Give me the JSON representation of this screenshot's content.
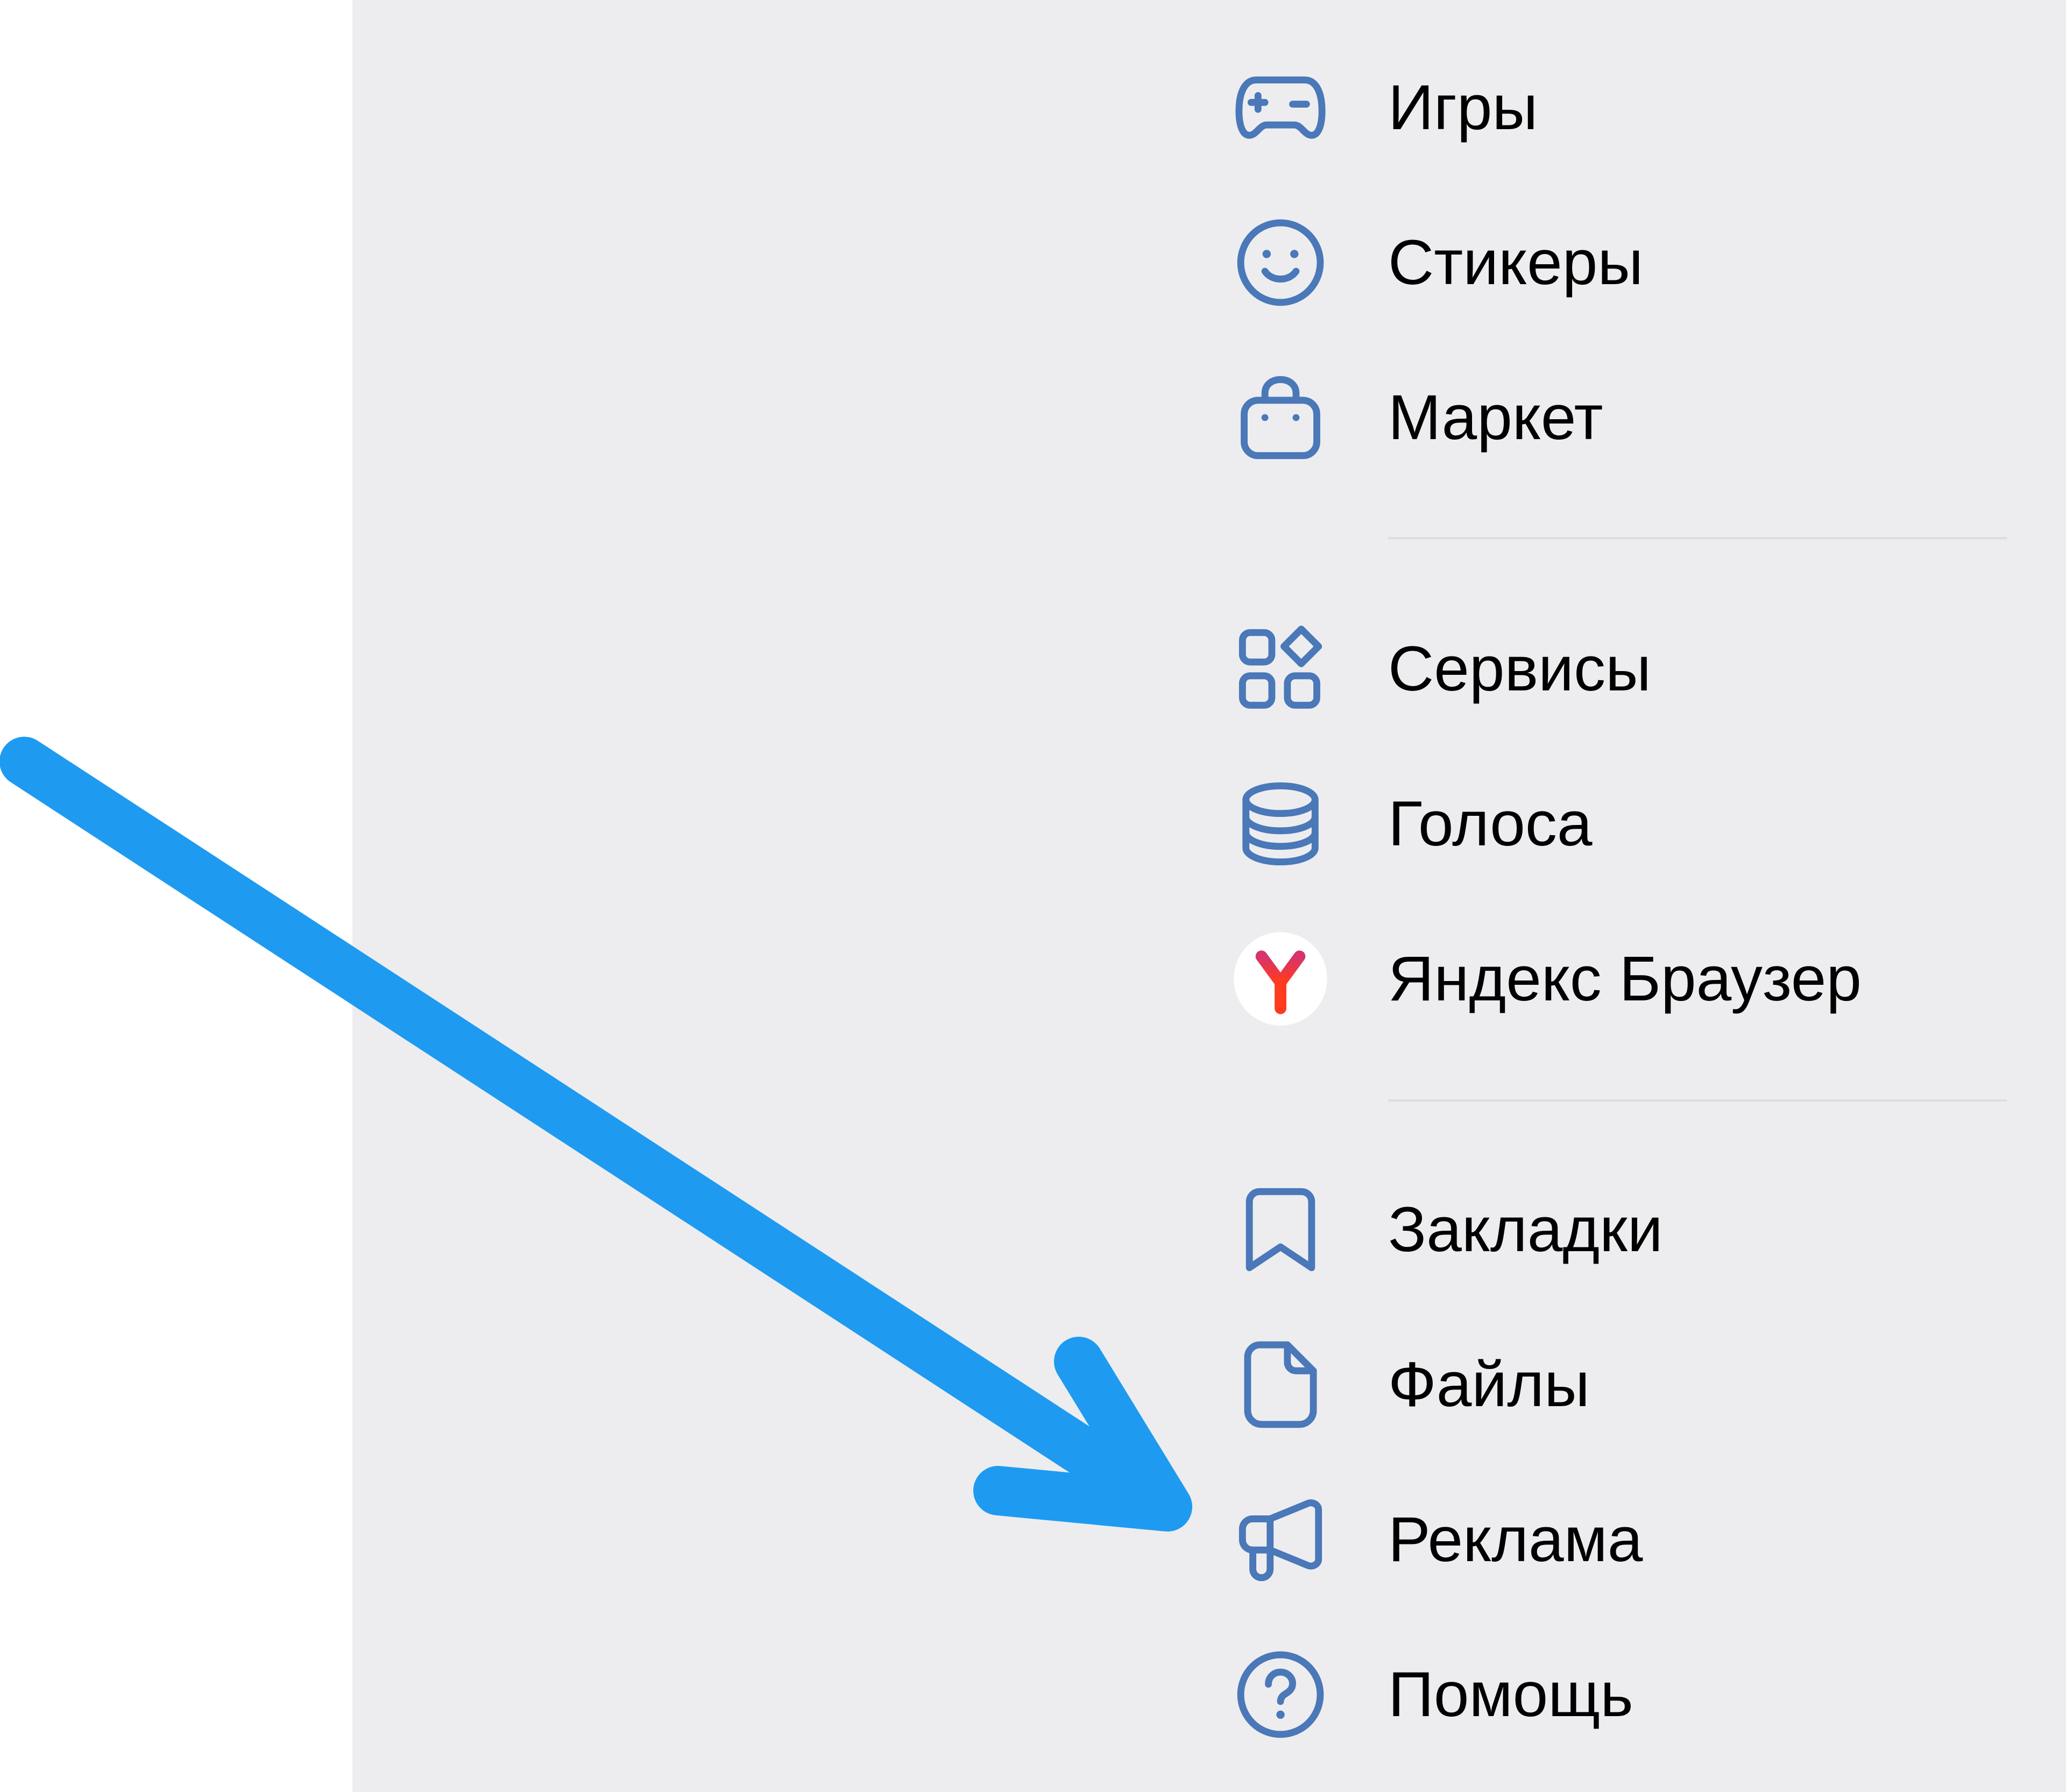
{
  "colors": {
    "panel_background": "#ededf0",
    "icon_stroke": "#4a78b8",
    "label_text": "#000000",
    "divider": "#dcdce1",
    "annotation_arrow": "#1e9bf0",
    "yandex_red": "#ff3b1f",
    "yandex_pink": "#d6336c"
  },
  "menu": {
    "groups": [
      {
        "items": [
          {
            "label": "Игры",
            "icon": "gamepad-icon"
          },
          {
            "label": "Стикеры",
            "icon": "smiley-icon"
          },
          {
            "label": "Маркет",
            "icon": "shopping-bag-icon"
          }
        ]
      },
      {
        "items": [
          {
            "label": "Сервисы",
            "icon": "services-grid-icon"
          },
          {
            "label": "Голоса",
            "icon": "coins-stack-icon"
          },
          {
            "label": "Яндекс Браузер",
            "icon": "yandex-browser-logo-icon"
          }
        ]
      },
      {
        "items": [
          {
            "label": "Закладки",
            "icon": "bookmark-icon"
          },
          {
            "label": "Файлы",
            "icon": "file-icon"
          },
          {
            "label": "Реклама",
            "icon": "megaphone-icon"
          },
          {
            "label": "Помощь",
            "icon": "help-circle-icon"
          }
        ]
      }
    ]
  },
  "annotation": {
    "type": "arrow",
    "points_to": "Реклама"
  }
}
